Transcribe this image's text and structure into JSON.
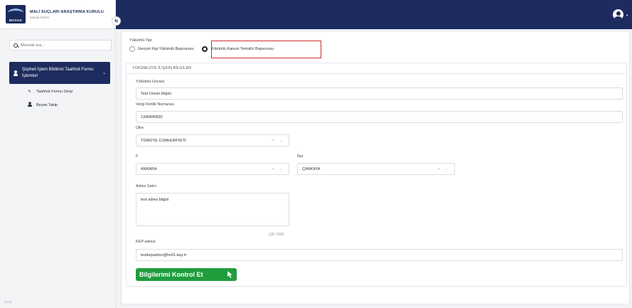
{
  "brand": {
    "logo_text": "MASAK",
    "title": "MALİ SUÇLARI ARAŞTIRMA KURULU",
    "subtitle": "Masak Online"
  },
  "search": {
    "placeholder": "Menüde ara..."
  },
  "sidebar": {
    "group_label": "Şüpheli İşlem Bildirimi Taahhüt Formu İşlemleri",
    "items": [
      {
        "label": "Taahhüt Formu Girişi",
        "icon": "pencil-icon"
      },
      {
        "label": "Beyan Takip",
        "icon": "user-icon"
      }
    ],
    "version": "0.1.0"
  },
  "form": {
    "obligor_type_label": "Yükümlü Tipi",
    "radio_options": [
      {
        "label": "Gerçek Kişi Yükümlü Başvurusu",
        "checked": false
      },
      {
        "label": "Yükümlü Kanuni Temsilci Başvurusu",
        "checked": true
      }
    ],
    "section_title": "YÜKÜMLÜYE İLİŞKİN BİLGİLER",
    "unvan_label": "Yükümlü Unvanı",
    "unvan_value": "Test Unvan bilgisi",
    "vkn_label": "Vergi Kimlik Numarası",
    "vkn_value": "1340845830",
    "country_label": "Ülke",
    "country_value": "TÜRKİYE CUMHURİYETİ",
    "city_label": "İl",
    "city_value": "ANKARA",
    "district_label": "İlçe",
    "district_value": "ÇANKAYA",
    "address_label": "Adres Satırı",
    "address_value": "test adres bilgisi",
    "address_counter": "(18 / 200)",
    "kep_label": "KEP adresi",
    "kep_value": "testkepadres@hs01.kep.tr",
    "submit_label": "Bilgilerimi Kontrol Et"
  },
  "colors": {
    "navy": "#1d2b5e",
    "green_button": "#1f9d3d",
    "highlight_red": "#d42a2a"
  }
}
